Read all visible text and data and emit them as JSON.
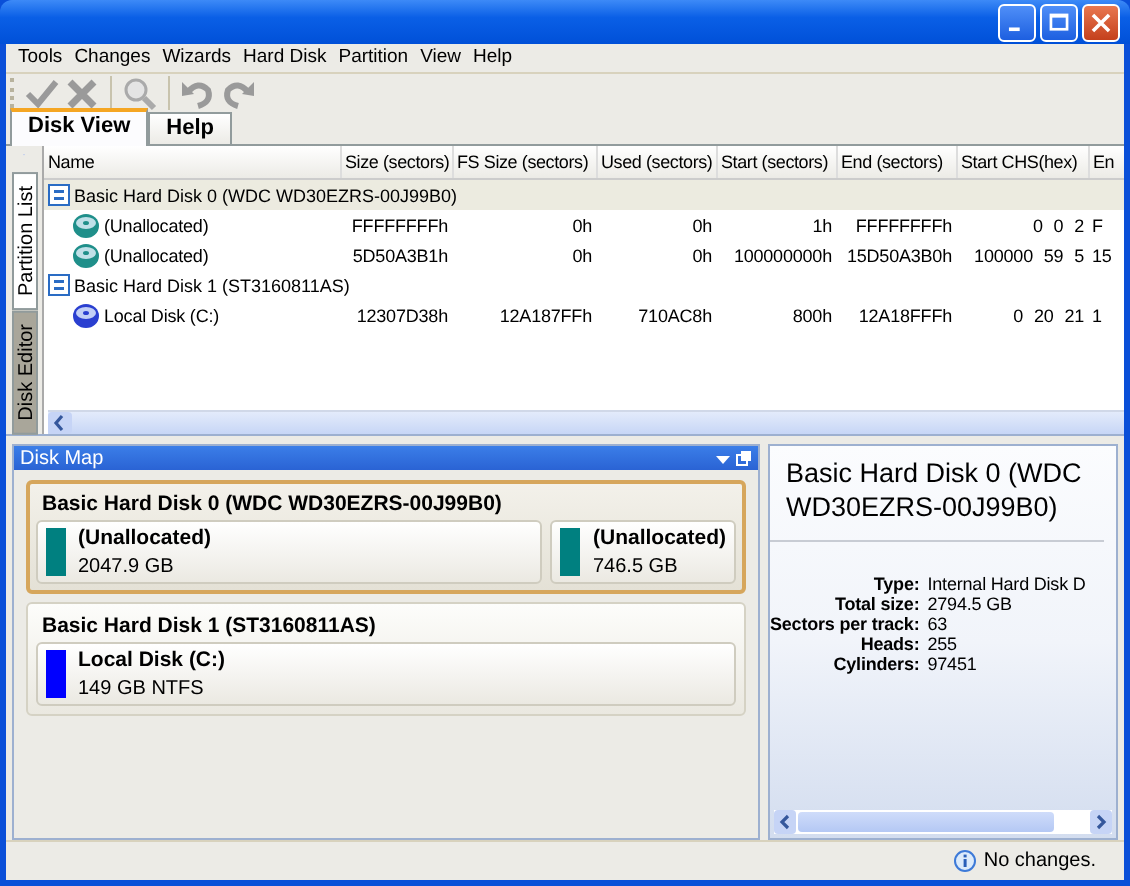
{
  "menu": [
    "Tools",
    "Changes",
    "Wizards",
    "Hard Disk",
    "Partition",
    "View",
    "Help"
  ],
  "tabs": [
    {
      "label": "Disk View",
      "selected": true
    },
    {
      "label": "Help",
      "selected": false
    }
  ],
  "side_tabs": [
    {
      "label": "Partition List",
      "selected": true
    },
    {
      "label": "Disk Editor",
      "selected": false
    }
  ],
  "table": {
    "columns": [
      "Name",
      "Size (sectors)",
      "FS Size (sectors)",
      "Used (sectors)",
      "Start (sectors)",
      "End (sectors)",
      "Start CHS(hex)",
      "En"
    ],
    "disks": [
      {
        "name": "Basic Hard Disk 0 (WDC WD30EZRS-00J99B0)",
        "selected": true,
        "rows": [
          {
            "kind": "unallocated",
            "cells": [
              "(Unallocated)",
              "FFFFFFFFh",
              "0h",
              "0h",
              "1h",
              "FFFFFFFFh",
              "0 0 2",
              "F"
            ]
          },
          {
            "kind": "unallocated",
            "cells": [
              "(Unallocated)",
              "5D50A3B1h",
              "0h",
              "0h",
              "100000000h",
              "15D50A3B0h",
              "100000 59 5",
              "15"
            ]
          }
        ]
      },
      {
        "name": "Basic Hard Disk 1 (ST3160811AS)",
        "selected": false,
        "rows": [
          {
            "kind": "volume",
            "cells": [
              "Local Disk (C:)",
              "12307D38h",
              "12A187FFh",
              "710AC8h",
              "800h",
              "12A18FFFh",
              "0 20 21",
              "1"
            ]
          }
        ]
      }
    ]
  },
  "disk_map": {
    "title": "Disk Map",
    "disks": [
      {
        "name": "Basic Hard Disk 0 (WDC WD30EZRS-00J99B0)",
        "selected": true,
        "partitions": [
          {
            "name": "(Unallocated)",
            "size": "2047.9 GB",
            "color": "#008080"
          },
          {
            "name": "(Unallocated)",
            "size": "746.5 GB",
            "color": "#008080"
          }
        ]
      },
      {
        "name": "Basic Hard Disk 1 (ST3160811AS)",
        "selected": false,
        "partitions": [
          {
            "name": "Local Disk (C:)",
            "size": "149 GB NTFS",
            "color": "#0000ff"
          }
        ]
      }
    ]
  },
  "info": {
    "title": "Basic Hard Disk 0 (WDC WD30EZRS-00J99B0)",
    "properties": [
      {
        "label": "Type:",
        "value": "Internal Hard Disk D"
      },
      {
        "label": "Total size:",
        "value": "2794.5 GB"
      },
      {
        "label": "Sectors per track:",
        "value": "63"
      },
      {
        "label": "Heads:",
        "value": "255"
      },
      {
        "label": "Cylinders:",
        "value": "97451"
      }
    ]
  },
  "status_bar": {
    "message": "No changes."
  }
}
